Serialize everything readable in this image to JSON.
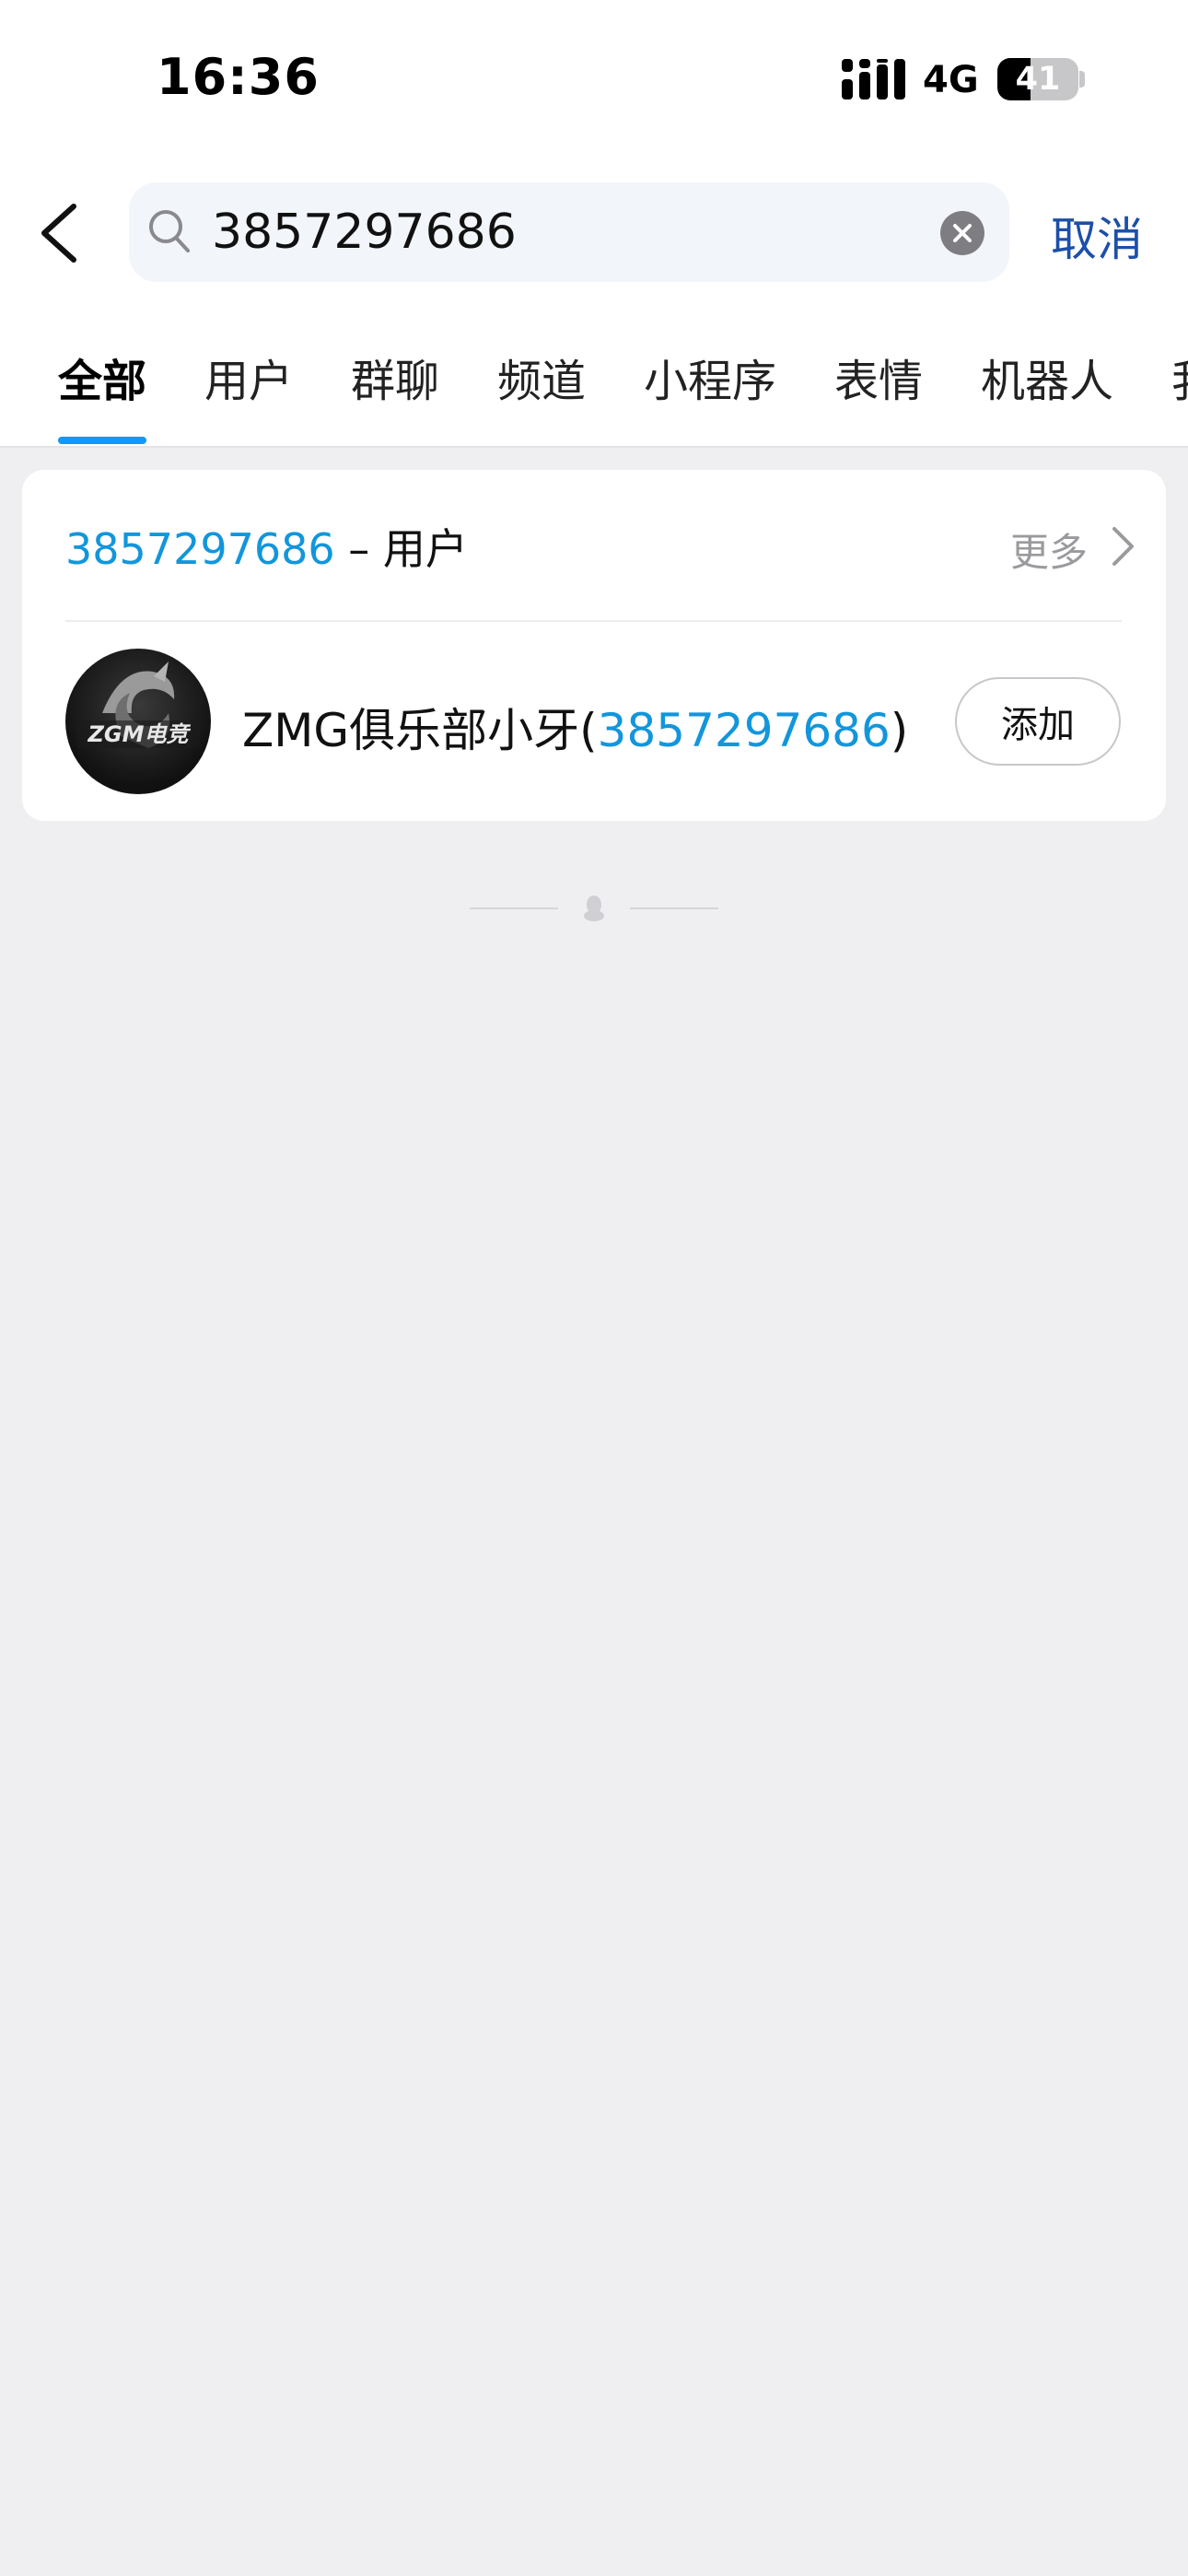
{
  "status_bar": {
    "time": "16:36",
    "network": "4G",
    "battery_level": "41",
    "battery_fraction": 0.41
  },
  "search": {
    "query": "3857297686",
    "cancel_label": "取消"
  },
  "tabs": [
    {
      "label": "全部",
      "active": true
    },
    {
      "label": "用户",
      "active": false
    },
    {
      "label": "群聊",
      "active": false
    },
    {
      "label": "频道",
      "active": false
    },
    {
      "label": "小程序",
      "active": false
    },
    {
      "label": "表情",
      "active": false
    },
    {
      "label": "机器人",
      "active": false
    },
    {
      "label": "我",
      "active": false
    }
  ],
  "result_section": {
    "query_highlight": "3857297686",
    "separator": " – ",
    "category": "用户",
    "more_label": "更多",
    "user": {
      "avatar_text": "ZGM电竞",
      "name_prefix": "ZMG俱乐部小牙(",
      "name_id": "3857297686",
      "name_suffix": ")",
      "add_label": "添加"
    }
  },
  "colors": {
    "accent_blue": "#1296db",
    "tab_indicator": "#0d99ff",
    "cancel_blue": "#1c4fa8",
    "background": "#efeff2"
  }
}
